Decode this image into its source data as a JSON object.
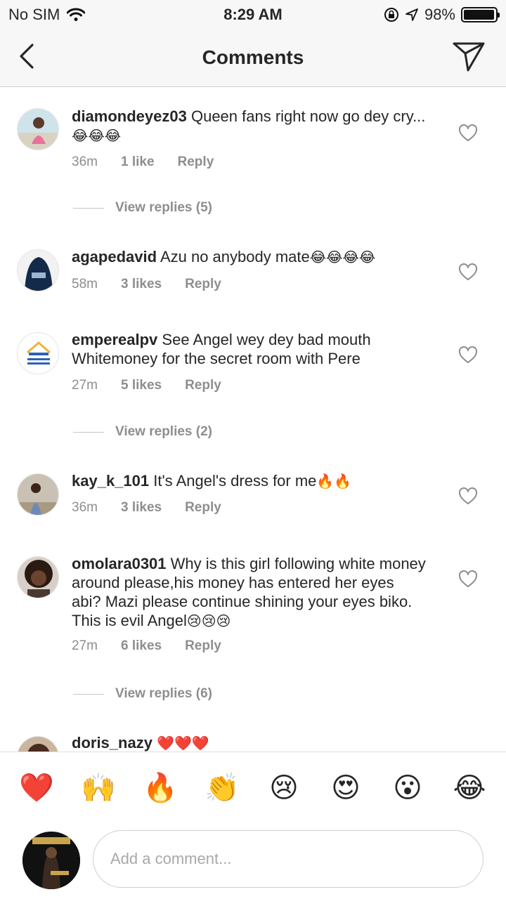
{
  "status": {
    "carrier": "No SIM",
    "time": "8:29 AM",
    "battery": "98%",
    "battery_level": 0.98
  },
  "header": {
    "title": "Comments"
  },
  "comments": [
    {
      "username": "diamondeyez03",
      "text": "Queen fans right now go dey cry...",
      "emoji": "😂😂😂",
      "time": "36m",
      "likes": "1 like",
      "reply": "Reply",
      "view_replies": "View replies (5)"
    },
    {
      "username": "agapedavid",
      "text": "Azu no anybody mate",
      "emoji": "😂😂😂😂",
      "time": "58m",
      "likes": "3 likes",
      "reply": "Reply"
    },
    {
      "username": "emperealpv",
      "text": "See Angel wey dey bad mouth Whitemoney for the secret room with Pere",
      "emoji": "",
      "time": "27m",
      "likes": "5 likes",
      "reply": "Reply",
      "view_replies": "View replies (2)"
    },
    {
      "username": "kay_k_101",
      "text": "It's Angel's dress for me",
      "emoji": "🔥🔥",
      "time": "36m",
      "likes": "3 likes",
      "reply": "Reply"
    },
    {
      "username": "omolara0301",
      "text": "Why is this girl following white money around please,his money has entered her eyes abi? Mazi please continue shining your eyes biko. This is evil Angel",
      "emoji": "😢😢😢",
      "time": "27m",
      "likes": "6 likes",
      "reply": "Reply",
      "view_replies": "View replies (6)"
    },
    {
      "username": "doris_nazy",
      "text": "",
      "emoji": "❤️❤️❤️"
    }
  ],
  "reactions": [
    "❤️",
    "🙌",
    "🔥",
    "👏",
    "😢",
    "😍",
    "😮",
    "😂"
  ],
  "composer": {
    "placeholder": "Add a comment..."
  },
  "icons": {
    "back": "chevron-left-icon",
    "share": "paper-plane-icon",
    "like": "heart-outline-icon"
  },
  "colors": {
    "muted": "#8e8e8e",
    "text": "#262626",
    "bar": "#f7f7f7"
  }
}
